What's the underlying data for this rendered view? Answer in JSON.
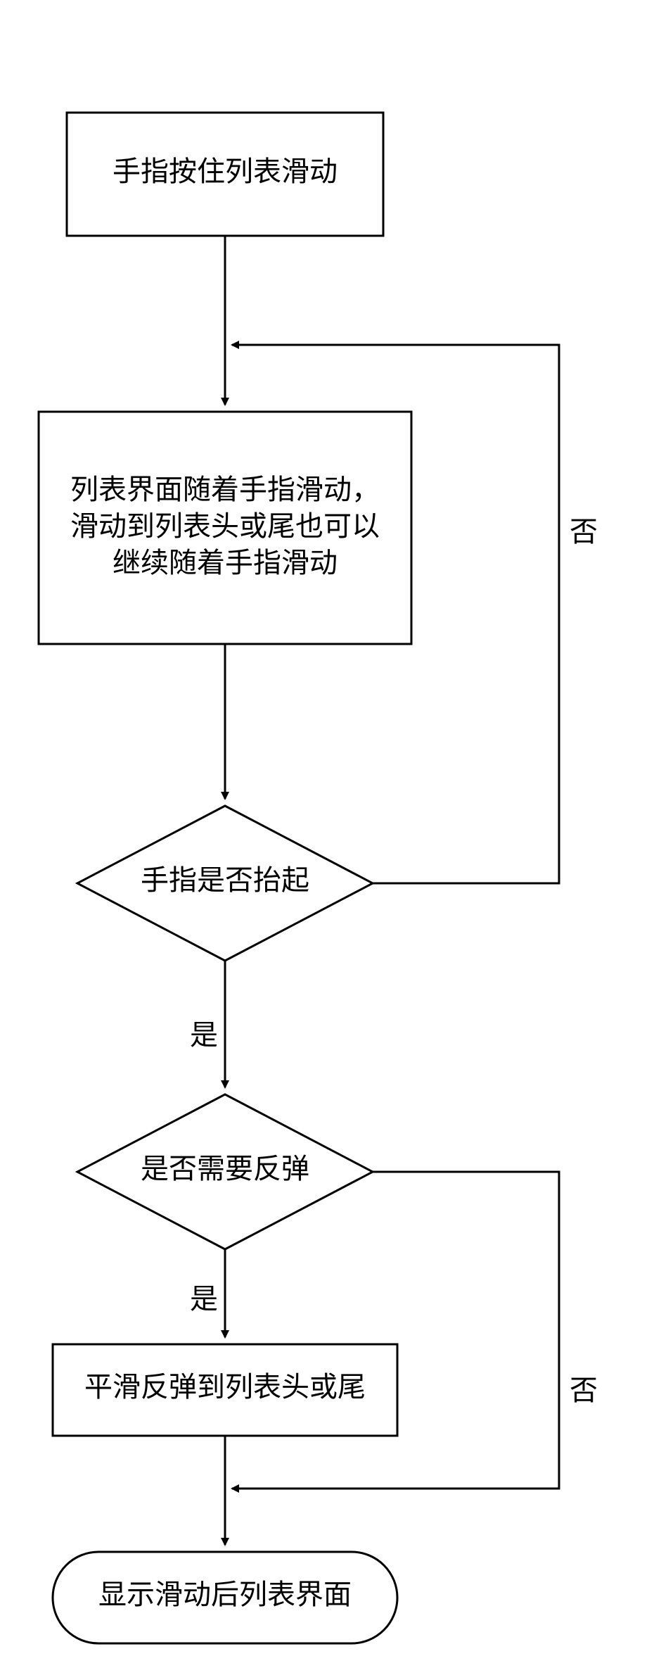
{
  "chart_data": {
    "type": "flowchart",
    "nodes": [
      {
        "id": "n1",
        "shape": "rect",
        "text": "手指按住列表滑动"
      },
      {
        "id": "n2",
        "shape": "rect",
        "text_lines": [
          "列表界面随着手指滑动，",
          "滑动到列表头或尾也可以",
          "继续随着手指滑动"
        ]
      },
      {
        "id": "d1",
        "shape": "diamond",
        "text": "手指是否抬起"
      },
      {
        "id": "d2",
        "shape": "diamond",
        "text": "是否需要反弹"
      },
      {
        "id": "n3",
        "shape": "rect",
        "text": "平滑反弹到列表头或尾"
      },
      {
        "id": "t1",
        "shape": "terminator",
        "text": "显示滑动后列表界面"
      }
    ],
    "edges": [
      {
        "from": "n1",
        "to": "n2",
        "label": ""
      },
      {
        "from": "n2",
        "to": "d1",
        "label": ""
      },
      {
        "from": "d1",
        "to": "d2",
        "label": "是"
      },
      {
        "from": "d1",
        "to": "n2",
        "label": "否"
      },
      {
        "from": "d2",
        "to": "n3",
        "label": "是"
      },
      {
        "from": "d2",
        "to": "t1",
        "label": "否"
      },
      {
        "from": "n3",
        "to": "t1",
        "label": ""
      }
    ]
  },
  "n1": {
    "text": "手指按住列表滑动"
  },
  "n2": {
    "l1": "列表界面随着手指滑动，",
    "l2": "滑动到列表头或尾也可以",
    "l3": "继续随着手指滑动"
  },
  "d1": {
    "text": "手指是否抬起"
  },
  "d2": {
    "text": "是否需要反弹"
  },
  "n3": {
    "text": "平滑反弹到列表头或尾"
  },
  "t1": {
    "text": "显示滑动后列表界面"
  },
  "labels": {
    "yes": "是",
    "no": "否"
  }
}
